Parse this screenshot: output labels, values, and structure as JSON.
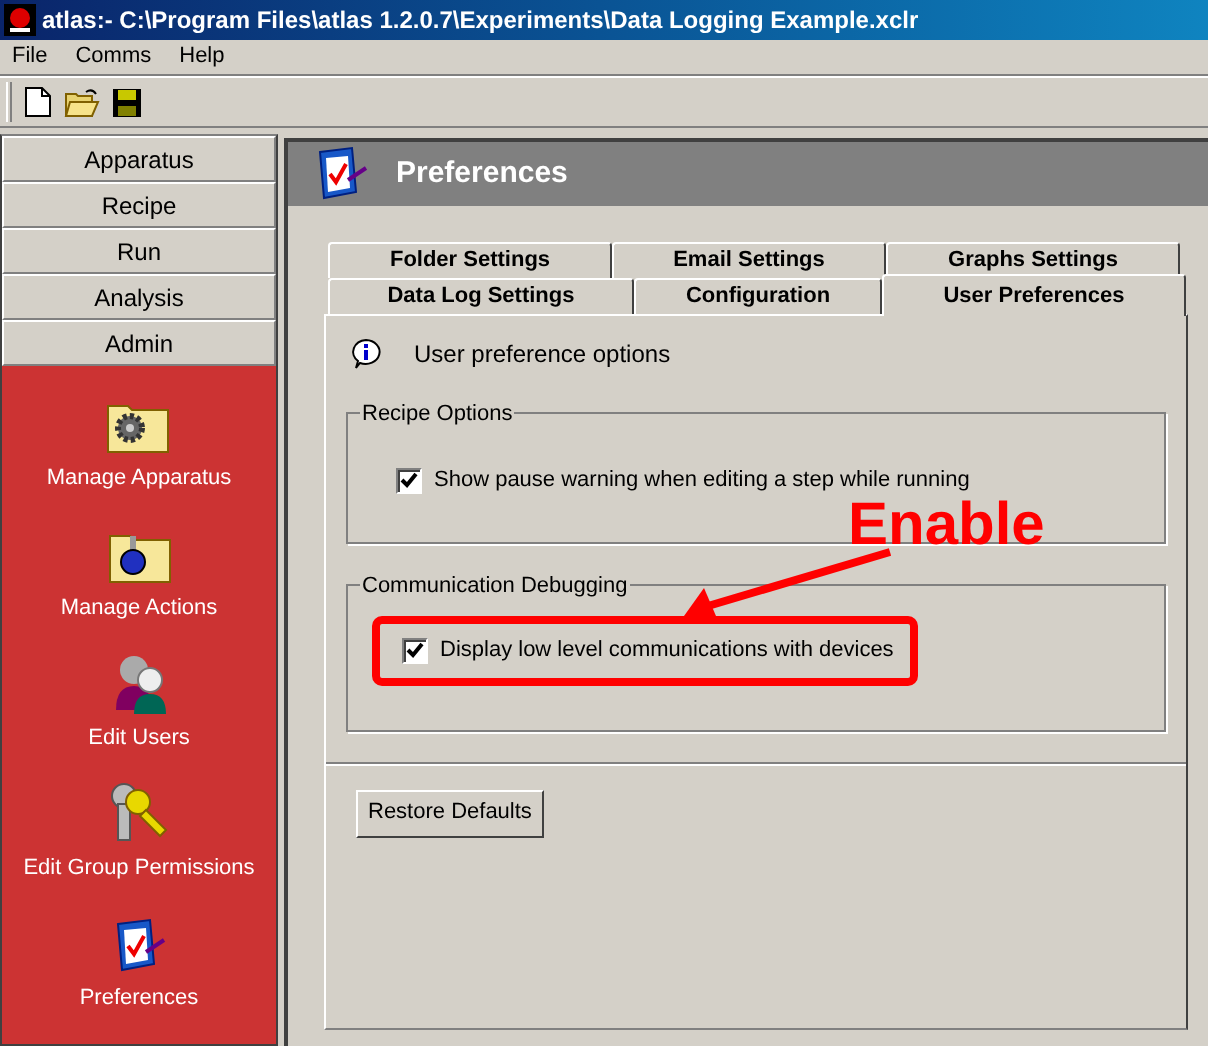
{
  "window": {
    "title": "atlas:- C:\\Program Files\\atlas 1.2.0.7\\Experiments\\Data Logging Example.xclr"
  },
  "menu": [
    {
      "label": "File"
    },
    {
      "label": "Comms"
    },
    {
      "label": "Help"
    }
  ],
  "sidebar": {
    "sections": [
      {
        "label": "Apparatus"
      },
      {
        "label": "Recipe"
      },
      {
        "label": "Run"
      },
      {
        "label": "Analysis"
      },
      {
        "label": "Admin"
      }
    ],
    "items": [
      {
        "label": "Manage Apparatus",
        "kind": "gear-folder"
      },
      {
        "label": "Manage Actions",
        "kind": "flask-folder"
      },
      {
        "label": "Edit Users",
        "kind": "users"
      },
      {
        "label": "Edit Group Permissions",
        "kind": "keys"
      },
      {
        "label": "Preferences",
        "kind": "clipboard"
      }
    ]
  },
  "panel": {
    "title": "Preferences",
    "tab_rows": [
      [
        {
          "label": "Folder Settings",
          "selected": false
        },
        {
          "label": "Email Settings",
          "selected": false
        },
        {
          "label": "Graphs Settings",
          "selected": false
        }
      ],
      [
        {
          "label": "Data Log Settings",
          "selected": false
        },
        {
          "label": "Configuration",
          "selected": false
        },
        {
          "label": "User Preferences",
          "selected": true
        }
      ]
    ],
    "info": "User preference options",
    "groups": [
      {
        "title": "Recipe Options",
        "options": [
          {
            "label": "Show pause warning when editing a step while running",
            "checked": true,
            "highlighted": false
          }
        ]
      },
      {
        "title": "Communication Debugging",
        "options": [
          {
            "label": "Display low level communications with devices",
            "checked": true,
            "highlighted": true
          }
        ]
      }
    ],
    "button": "Restore Defaults"
  },
  "annotation": {
    "text": "Enable"
  }
}
